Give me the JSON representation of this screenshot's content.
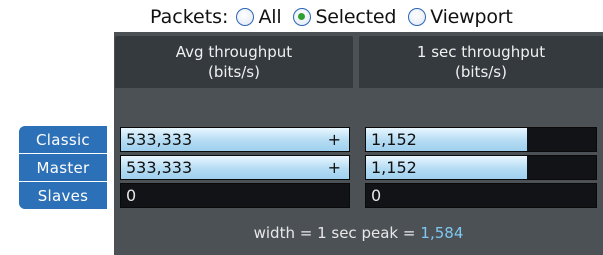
{
  "packets": {
    "label": "Packets:",
    "options": [
      {
        "label": "All",
        "selected": false
      },
      {
        "label": "Selected",
        "selected": true
      },
      {
        "label": "Viewport",
        "selected": false
      }
    ]
  },
  "headers": {
    "avg_line1": "Avg throughput",
    "avg_line2": "(bits/s)",
    "one_line1": "1 sec throughput",
    "one_line2": "(bits/s)"
  },
  "rows": [
    {
      "label": "Classic",
      "avg": "533,333",
      "avg_plus": "+",
      "avg_fill": 1.0,
      "one": "1,152",
      "one_fill": 0.7
    },
    {
      "label": "Master",
      "avg": "533,333",
      "avg_plus": "+",
      "avg_fill": 1.0,
      "one": "1,152",
      "one_fill": 0.7
    },
    {
      "label": "Slaves",
      "avg": "0",
      "avg_plus": "",
      "avg_fill": 0.0,
      "one": "0",
      "one_fill": 0.0
    }
  ],
  "footer": {
    "text": "width = 1 sec peak =",
    "peak": "1,584"
  },
  "colors": {
    "accent_blue": "#2c70b8",
    "panel_dark": "#4c5156",
    "header_dark": "#353a3f",
    "bar_fill": "#b5dcf3",
    "peak_value": "#7fc8f2",
    "radio_selected": "#2fa02f"
  }
}
